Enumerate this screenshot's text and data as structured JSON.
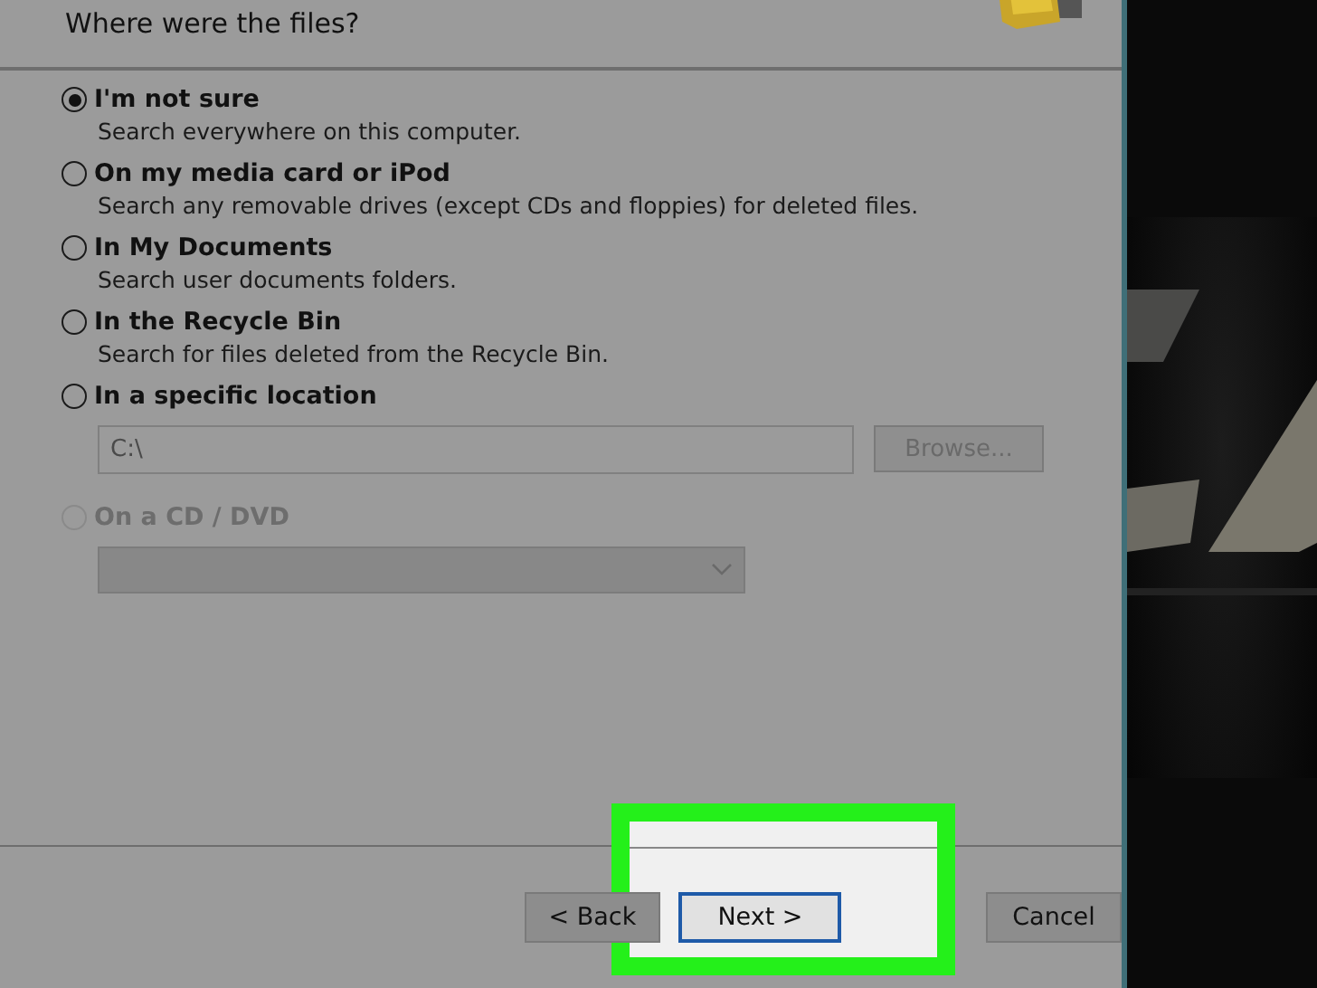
{
  "header": {
    "title": "Where were the files?"
  },
  "options": [
    {
      "label": "I'm not sure",
      "description": "Search everywhere on this computer.",
      "selected": true,
      "disabled": false
    },
    {
      "label": "On my media card or iPod",
      "description": "Search any removable drives (except CDs and floppies) for deleted files.",
      "selected": false,
      "disabled": false
    },
    {
      "label": "In My Documents",
      "description": "Search user documents folders.",
      "selected": false,
      "disabled": false
    },
    {
      "label": "In the Recycle Bin",
      "description": "Search for files deleted from the Recycle Bin.",
      "selected": false,
      "disabled": false
    },
    {
      "label": "In a specific location",
      "selected": false,
      "disabled": false,
      "path": {
        "value": "C:\\",
        "disabled": true
      },
      "browse": {
        "label": "Browse...",
        "disabled": true
      }
    },
    {
      "label": "On a CD / DVD",
      "selected": false,
      "disabled": true,
      "dropdown": {
        "disabled": true
      }
    }
  ],
  "buttons": [
    {
      "label": "< Back",
      "default": false,
      "highlighted": false
    },
    {
      "label": "Next >",
      "default": true,
      "highlighted": true
    },
    {
      "label": "Cancel",
      "default": false,
      "highlighted": false
    }
  ]
}
